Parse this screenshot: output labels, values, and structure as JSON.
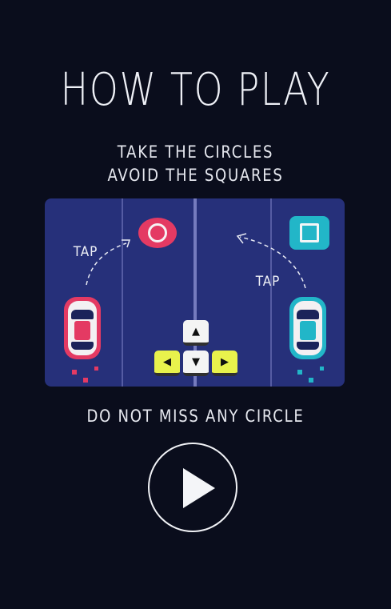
{
  "title": "HOW TO PLAY",
  "instructions": {
    "line1": "TAKE THE CIRCLES",
    "line2": "AVOID THE SQUARES",
    "line3": "DO NOT MISS ANY CIRCLE"
  },
  "board": {
    "tap_left": "TAP",
    "tap_right": "TAP",
    "colors": {
      "background": "#26307a",
      "red": "#e43a63",
      "blue": "#22b6c8",
      "key_yellow": "#e8f24c"
    },
    "icons": [
      "circle-token",
      "square-token",
      "red-car-icon",
      "blue-car-icon",
      "arrow-keys-icon"
    ]
  },
  "play_button": {
    "icon": "play-icon"
  }
}
